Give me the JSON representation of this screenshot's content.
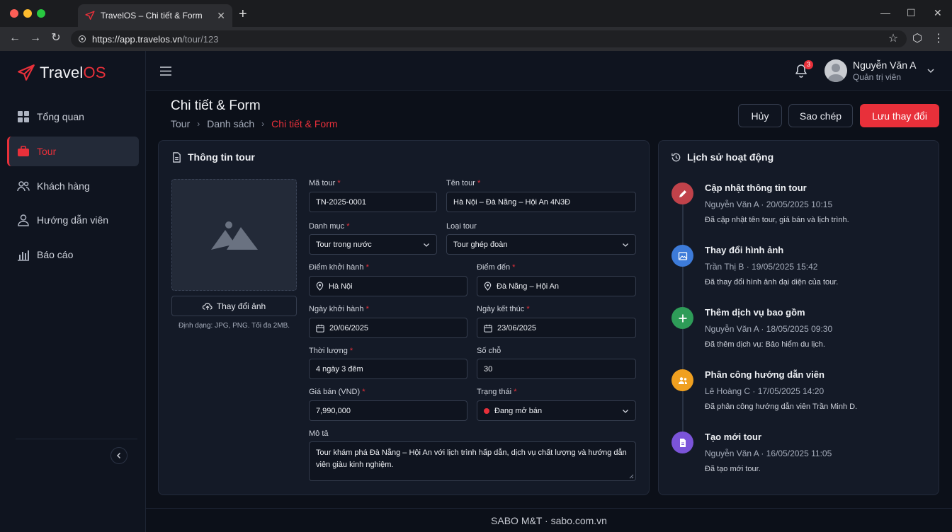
{
  "browser": {
    "tab_title": "TravelOS – Chi tiết & Form",
    "url_host": "https://app.travelos.vn",
    "url_path": "/tour/123"
  },
  "brand": {
    "name_a": "Travel",
    "name_b": "OS",
    "accent": "#e8303a"
  },
  "sidebar": {
    "items": [
      {
        "label": "Tổng quan",
        "icon": "dashboard-icon"
      },
      {
        "label": "Tour",
        "icon": "briefcase-icon",
        "active": true
      },
      {
        "label": "Khách hàng",
        "icon": "users-icon"
      },
      {
        "label": "Hướng dẫn viên",
        "icon": "user-icon"
      },
      {
        "label": "Báo cáo",
        "icon": "bar-chart-icon"
      }
    ]
  },
  "topbar": {
    "notification_count": "3",
    "user_name": "Nguyễn Văn A",
    "user_role": "Quản trị viên"
  },
  "page": {
    "title": "Chi tiết & Form",
    "breadcrumb": [
      "Tour",
      "Danh sách",
      "Chi tiết & Form"
    ]
  },
  "actions": {
    "cancel": "Hủy",
    "copy": "Sao chép",
    "save": "Lưu thay đổi"
  },
  "form": {
    "card_title": "Thông tin tour",
    "image_button": "Thay đổi ảnh",
    "image_hint": "Định dạng: JPG, PNG. Tối đa 2MB.",
    "code_label": "Mã tour",
    "code_value": "TN-2025-0001",
    "name_label": "Tên tour",
    "name_value": "Hà Nội – Đà Nẵng – Hội An 4N3Đ",
    "category_label": "Danh mục",
    "category_value": "Tour trong nước",
    "type_label": "Loại tour",
    "type_value": "Tour ghép đoàn",
    "from_label": "Điểm khởi hành",
    "from_value": "Hà Nội",
    "to_label": "Điểm đến",
    "to_value": "Đà Nẵng – Hội An",
    "start_label": "Ngày khởi hành",
    "start_value": "20/06/2025",
    "end_label": "Ngày kết thúc",
    "end_value": "23/06/2025",
    "duration_label": "Thời lượng",
    "duration_value": "4 ngày 3 đêm",
    "seats_label": "Số chỗ",
    "seats_value": "30",
    "price_label": "Giá bán (VND)",
    "price_value": "7,990,000",
    "status_label": "Trạng thái",
    "status_value": "Đang mở bán",
    "desc_label": "Mô tả",
    "desc_value": "Tour khám phá Đà Nẵng – Hội An với lịch trình hấp dẫn, dịch vụ chất lượng và hướng dẫn viên giàu kinh nghiệm."
  },
  "history": {
    "title": "Lịch sử hoạt động",
    "items": [
      {
        "title": "Cập nhật thông tin tour",
        "meta": "Nguyễn Văn A · 20/05/2025 10:15",
        "desc": "Đã cập nhật tên tour, giá bán và lịch trình.",
        "color": "#c0424a",
        "icon": "pencil-icon"
      },
      {
        "title": "Thay đổi hình ảnh",
        "meta": "Trần Thị B · 19/05/2025 15:42",
        "desc": "Đã thay đổi hình ảnh đại diện của tour.",
        "color": "#3d7bd9",
        "icon": "image-icon"
      },
      {
        "title": "Thêm dịch vụ bao gồm",
        "meta": "Nguyễn Văn A · 18/05/2025 09:30",
        "desc": "Đã thêm dịch vụ: Bảo hiểm du lịch.",
        "color": "#2e9c58",
        "icon": "plus-icon"
      },
      {
        "title": "Phân công hướng dẫn viên",
        "meta": "Lê Hoàng C · 17/05/2025 14:20",
        "desc": "Đã phân công hướng dẫn viên Trần Minh D.",
        "color": "#f0a020",
        "icon": "user-assign-icon"
      },
      {
        "title": "Tạo mới tour",
        "meta": "Nguyễn Văn A · 16/05/2025 11:05",
        "desc": "Đã tạo mới tour.",
        "color": "#7b54d9",
        "icon": "document-icon"
      }
    ]
  },
  "footer": {
    "text": "SABO M&T · sabo.com.vn"
  }
}
